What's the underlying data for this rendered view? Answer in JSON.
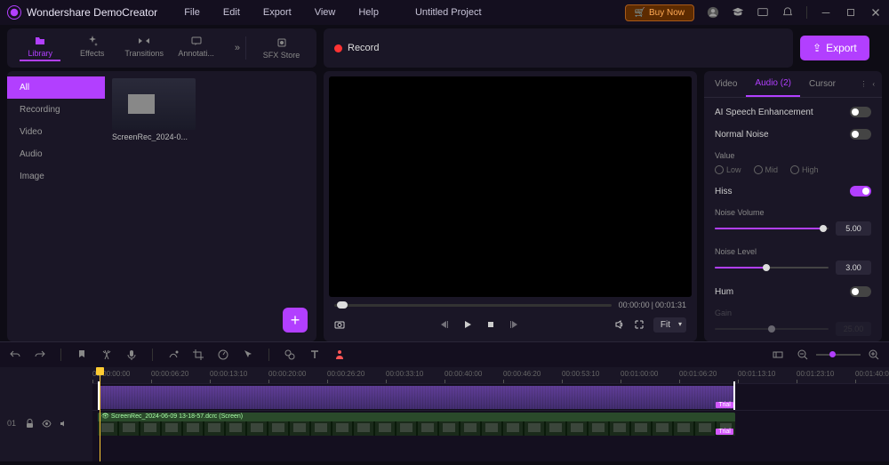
{
  "app_name": "Wondershare DemoCreator",
  "menus": [
    "File",
    "Edit",
    "Export",
    "View",
    "Help"
  ],
  "project_title": "Untitled Project",
  "buy_label": "Buy Now",
  "tabs": {
    "items": [
      {
        "label": "Library",
        "active": true
      },
      {
        "label": "Effects"
      },
      {
        "label": "Transitions"
      },
      {
        "label": "Annotati..."
      }
    ],
    "sfx": "SFX Store"
  },
  "record_label": "Record",
  "export_label": "Export",
  "categories": [
    "All",
    "Recording",
    "Video",
    "Audio",
    "Image"
  ],
  "active_category": "All",
  "clip": {
    "name": "ScreenRec_2024-0..."
  },
  "preview": {
    "time_current": "00:00:00",
    "time_total": "00:01:31",
    "fit": "Fit"
  },
  "props": {
    "tabs": [
      "Video",
      "Audio (2)",
      "Cursor"
    ],
    "active_tab": "Audio (2)",
    "ai_speech": {
      "label": "AI Speech Enhancement",
      "on": false
    },
    "normal_noise": {
      "label": "Normal Noise",
      "on": false
    },
    "value_label": "Value",
    "value_opts": [
      "Low",
      "Mid",
      "High"
    ],
    "hiss": {
      "label": "Hiss",
      "on": true
    },
    "noise_volume": {
      "label": "Noise Volume",
      "value": "5.00",
      "pct": 95
    },
    "noise_level": {
      "label": "Noise Level",
      "value": "3.00",
      "pct": 45
    },
    "hum": {
      "label": "Hum",
      "on": false
    },
    "gain": {
      "label": "Gain",
      "value": "25.00",
      "pct": 50
    }
  },
  "timeline": {
    "ruler": [
      "00:00:00:00",
      "00:00:06:20",
      "00:00:13:10",
      "00:00:20:00",
      "00:00:26:20",
      "00:00:33:10",
      "00:00:40:00",
      "00:00:46:20",
      "00:00:53:10",
      "00:01:00:00",
      "00:01:06:20",
      "00:01:13:10",
      "00:01:23:10",
      "00:01:40:00"
    ],
    "track_nums": [
      "01"
    ],
    "video_clip_label": "ScreenRec_2024-06-09 13-18-57.dcrc (Screen)",
    "trial_badge": "Trial"
  }
}
